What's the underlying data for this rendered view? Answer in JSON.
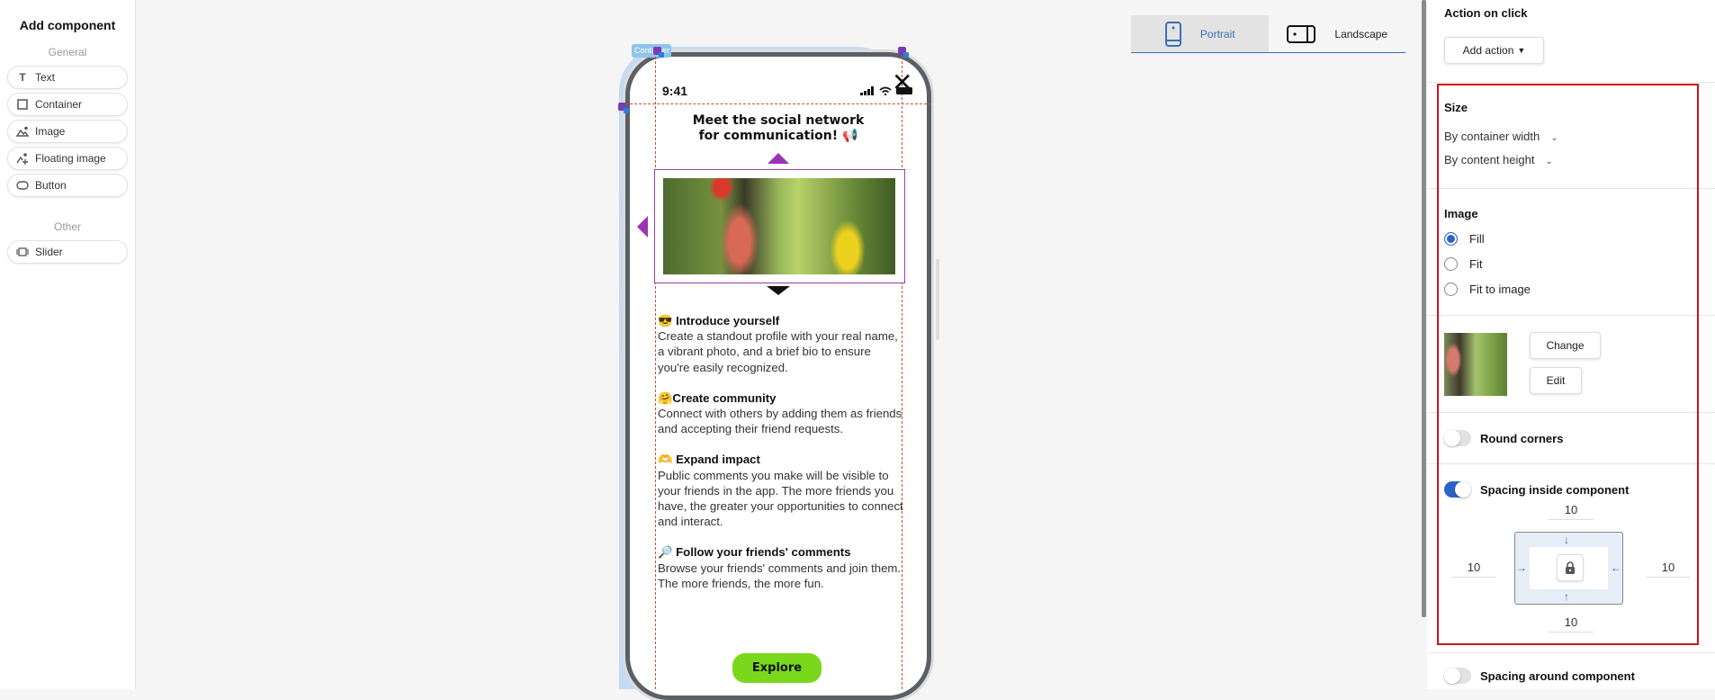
{
  "left_panel": {
    "title": "Add component",
    "groups": [
      {
        "label": "General",
        "items": [
          {
            "label": "Text",
            "icon": "text-icon"
          },
          {
            "label": "Container",
            "icon": "container-icon"
          },
          {
            "label": "Image",
            "icon": "image-icon"
          },
          {
            "label": "Floating image",
            "icon": "floating-image-icon"
          },
          {
            "label": "Button",
            "icon": "button-icon"
          }
        ]
      },
      {
        "label": "Other",
        "items": [
          {
            "label": "Slider",
            "icon": "slider-icon"
          }
        ]
      }
    ]
  },
  "orientation": {
    "tabs": [
      {
        "label": "Portrait",
        "active": true
      },
      {
        "label": "Landscape",
        "active": false
      }
    ]
  },
  "preview": {
    "selection_label": "Container",
    "status_time": "9:41",
    "headline": "Meet the social network for communication! 📢",
    "headline_line1": "Meet the social network",
    "headline_line2": "for communication! 📢",
    "sections": [
      {
        "emoji": "😎",
        "title": "Introduce yourself",
        "body": "Create a standout profile with your real name, a vibrant photo, and a brief bio to ensure you're easily recognized."
      },
      {
        "emoji": "🤗",
        "title": "Create community",
        "body": "Connect with others by adding them as friends and accepting their friend requests."
      },
      {
        "emoji": "🫶",
        "title": "Expand impact",
        "body": "Public comments you make will be visible to your friends in the app. The more friends you have, the greater your opportunities to connect and interact."
      },
      {
        "emoji": "🔎",
        "title": "Follow your friends' comments",
        "body": "Browse your friends' comments and join them. The more friends, the more fun."
      }
    ],
    "cta_label": "Explore",
    "cta_color": "#7ad81c"
  },
  "properties": {
    "action_on_click": {
      "title": "Action on click",
      "button_label": "Add action"
    },
    "size": {
      "title": "Size",
      "width_option": "By container width",
      "height_option": "By content height"
    },
    "image": {
      "title": "Image",
      "options": [
        {
          "label": "Fill",
          "selected": true
        },
        {
          "label": "Fit",
          "selected": false
        },
        {
          "label": "Fit to image",
          "selected": false
        }
      ],
      "change_label": "Change",
      "edit_label": "Edit"
    },
    "round_corners": {
      "label": "Round corners",
      "enabled": false
    },
    "spacing_inside": {
      "label": "Spacing inside component",
      "enabled": true,
      "top": "10",
      "left": "10",
      "right": "10",
      "bottom": "10",
      "locked": true
    },
    "spacing_around": {
      "label": "Spacing around component",
      "enabled": false
    }
  },
  "colors": {
    "accent": "#2d63c9",
    "highlight_box": "#d0131b",
    "selection_handle": "#7b3bb5"
  }
}
